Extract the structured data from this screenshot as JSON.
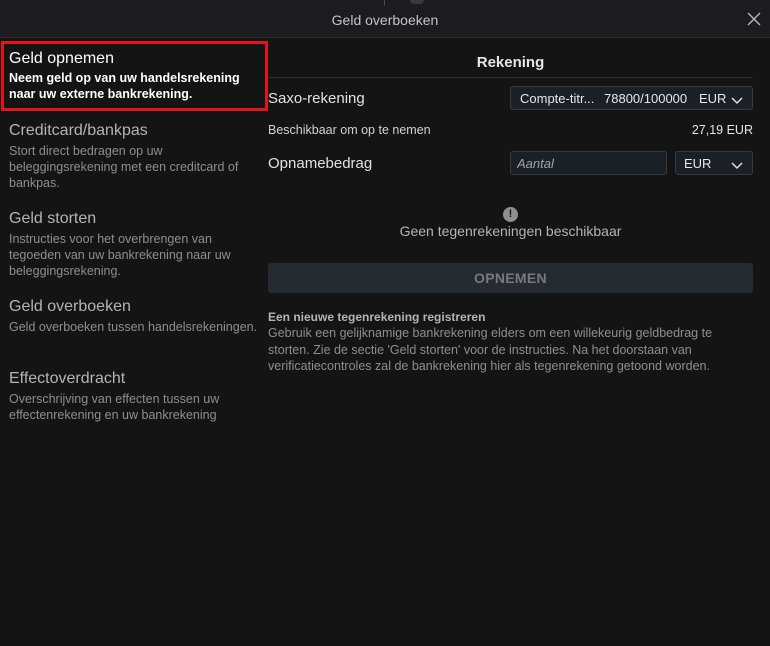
{
  "window": {
    "title": "Geld overboeken",
    "close_icon": "close-icon"
  },
  "sidebar": {
    "items": [
      {
        "title": "Geld opnemen",
        "description": "Neem geld op van uw handelsrekening naar uw externe bankrekening.",
        "active": true
      },
      {
        "title": "Creditcard/bankpas",
        "description": "Stort direct bedragen op uw beleggingsrekening met een creditcard of bankpas.",
        "active": false
      },
      {
        "title": "Geld storten",
        "description": "Instructies voor het overbrengen van tegoeden van uw bankrekening naar uw beleggingsrekening.",
        "active": false
      },
      {
        "title": "Geld overboeken",
        "description": "Geld overboeken tussen handelsrekeningen.",
        "active": false
      },
      {
        "title": "Effectoverdracht",
        "description": "Overschrijving van effecten tussen uw effectenrekening en uw bankrekening",
        "active": false
      }
    ],
    "highlight_color": "#e0141b"
  },
  "main": {
    "section_title": "Rekening",
    "account": {
      "label": "Saxo-rekening",
      "name": "Compte-titr...",
      "id": "78800/100000",
      "currency": "EUR"
    },
    "available": {
      "label": "Beschikbaar om op te nemen",
      "value": "27,19 EUR"
    },
    "amount": {
      "label": "Opnamebedrag",
      "placeholder": "Aantal",
      "value": "",
      "currency": "EUR"
    },
    "no_accounts": {
      "icon": "warning-icon",
      "icon_glyph": "!",
      "text": "Geen tegenrekeningen beschikbaar"
    },
    "withdraw_button": "OPNEMEN",
    "info": {
      "title": "Een nieuwe tegenrekening registreren",
      "text": "Gebruik een gelijknamige bankrekening elders om een willekeurig geldbedrag te storten. Zie de sectie 'Geld storten' voor de instructies. Na het doorstaan van verificatiecontroles zal de bankrekening hier als tegenrekening getoond worden."
    }
  }
}
